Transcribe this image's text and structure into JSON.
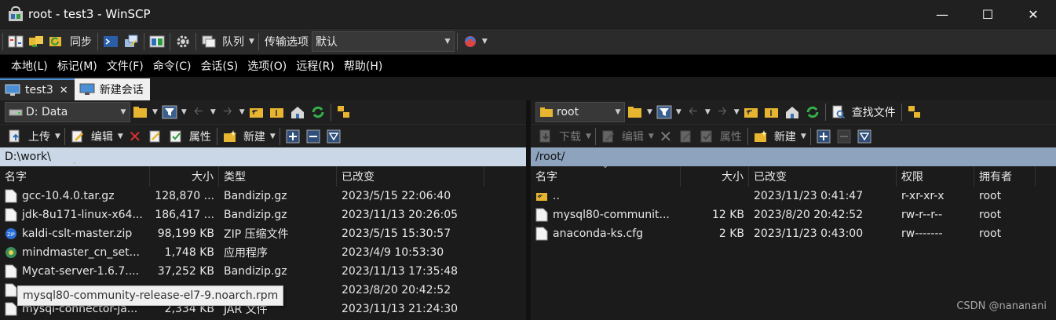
{
  "window": {
    "title": "root - test3 - WinSCP"
  },
  "toolbar": {
    "sync_label": "同步",
    "queue_label": "队列",
    "transfer_options_label": "传输选项",
    "transfer_preset": "默认"
  },
  "menu": [
    "本地(L)",
    "标记(M)",
    "文件(F)",
    "命令(C)",
    "会话(S)",
    "选项(O)",
    "远程(R)",
    "帮助(H)"
  ],
  "tabs": [
    {
      "label": "test3"
    },
    {
      "label": "新建会话"
    }
  ],
  "left": {
    "drive": "D: Data",
    "actions": {
      "upload": "上传",
      "edit": "编辑",
      "properties": "属性",
      "new": "新建"
    },
    "path": "D:\\work\\",
    "columns": [
      "名字",
      "大小",
      "类型",
      "已改变"
    ],
    "rows": [
      {
        "name": "gcc-10.4.0.tar.gz",
        "size": "128,870 ...",
        "type": "Bandizip.gz",
        "changed": "2023/5/15  22:06:40"
      },
      {
        "name": "jdk-8u171-linux-x64...",
        "size": "186,417 ...",
        "type": "Bandizip.gz",
        "changed": "2023/11/13  20:26:05"
      },
      {
        "name": "kaldi-cslt-master.zip",
        "size": "98,199 KB",
        "type": "ZIP 压缩文件",
        "changed": "2023/5/15  15:30:57"
      },
      {
        "name": "mindmaster_cn_set...",
        "size": "1,748 KB",
        "type": "应用程序",
        "changed": "2023/4/9  10:53:30"
      },
      {
        "name": "Mycat-server-1.6.7....",
        "size": "37,252 KB",
        "type": "Bandizip.gz",
        "changed": "2023/11/13  17:35:48"
      },
      {
        "name": "",
        "size": "",
        "type": "",
        "changed": "2023/8/20  20:42:52"
      },
      {
        "name": "mysql-connector-ja...",
        "size": "2,334 KB",
        "type": "JAR 文件",
        "changed": "2023/11/13  21:24:30"
      }
    ],
    "tooltip": "mysql80-community-release-el7-9.noarch.rpm"
  },
  "right": {
    "dir": "root",
    "find_files_label": "查找文件",
    "actions": {
      "download": "下载",
      "edit": "编辑",
      "properties": "属性",
      "new": "新建"
    },
    "path": "/root/",
    "columns": [
      "名字",
      "大小",
      "已改变",
      "权限",
      "拥有者"
    ],
    "rows": [
      {
        "name": "..",
        "size": "",
        "changed": "2023/11/23 0:41:47",
        "perms": "r-xr-xr-x",
        "owner": "root"
      },
      {
        "name": "mysql80-communit...",
        "size": "12 KB",
        "changed": "2023/8/20 20:42:52",
        "perms": "rw-r--r--",
        "owner": "root"
      },
      {
        "name": "anaconda-ks.cfg",
        "size": "2 KB",
        "changed": "2023/11/23 0:43:00",
        "perms": "rw-------",
        "owner": "root"
      }
    ]
  },
  "watermark": "CSDN @nananani",
  "colors": {
    "accent": "#4a90d9",
    "left_path_bg": "#c9d7e6",
    "right_path_bg": "#8ea3bd"
  }
}
